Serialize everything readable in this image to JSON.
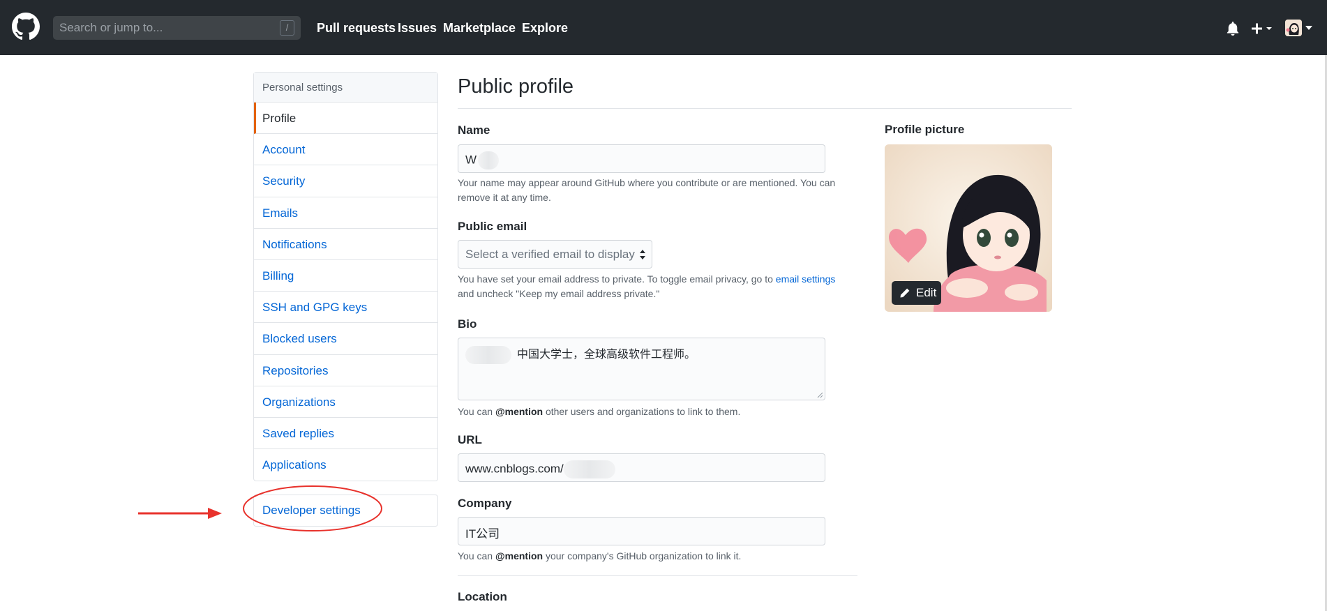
{
  "header": {
    "search_placeholder": "Search or jump to...",
    "search_shortcut": "/",
    "nav": [
      "Pull requests",
      "Issues",
      "Marketplace",
      "Explore"
    ]
  },
  "sidebar": {
    "heading": "Personal settings",
    "items": [
      "Profile",
      "Account",
      "Security",
      "Emails",
      "Notifications",
      "Billing",
      "SSH and GPG keys",
      "Blocked users",
      "Repositories",
      "Organizations",
      "Saved replies",
      "Applications"
    ],
    "developer_settings": "Developer settings"
  },
  "profile": {
    "title": "Public profile",
    "name": {
      "label": "Name",
      "value": "W",
      "help": "Your name may appear around GitHub where you contribute or are mentioned. You can remove it at any time."
    },
    "public_email": {
      "label": "Public email",
      "placeholder": "Select a verified email to display",
      "help_before": "You have set your email address to private. To toggle email privacy, go to ",
      "help_link": "email settings",
      "help_after": "and uncheck \"Keep my email address private.\""
    },
    "bio": {
      "label": "Bio",
      "value": "中国大学士，全球高级软件工程师。",
      "help_before": "You can ",
      "help_mention": "@mention",
      "help_after": " other users and organizations to link to them."
    },
    "url": {
      "label": "URL",
      "value": "www.cnblogs.com/"
    },
    "company": {
      "label": "Company",
      "value": "IT公司",
      "help_before": "You can ",
      "help_mention": "@mention",
      "help_after": " your company's GitHub organization to link it."
    },
    "location": {
      "label": "Location"
    },
    "picture": {
      "label": "Profile picture",
      "edit_label": "Edit"
    }
  },
  "colors": {
    "header_bg": "#24292e",
    "link": "#0366d6",
    "active_marker": "#e36209",
    "annotation_red": "#e8322c"
  }
}
